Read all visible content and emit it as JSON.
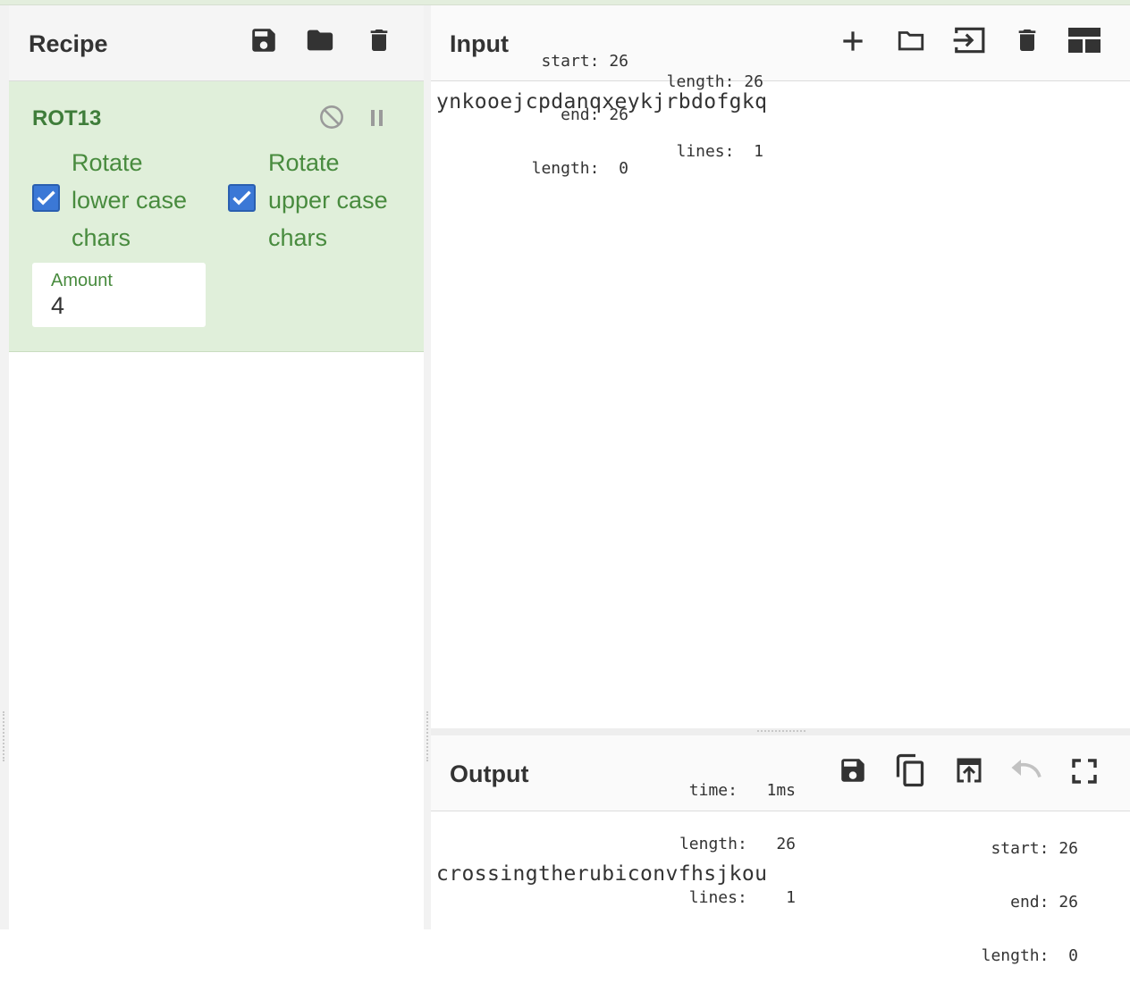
{
  "recipe": {
    "title": "Recipe",
    "icons": [
      "save-icon",
      "folder-icon",
      "trash-icon"
    ],
    "operation": {
      "name": "ROT13",
      "icons": [
        "disable-icon",
        "pause-icon"
      ],
      "options": [
        {
          "label_lines": [
            "Rotate",
            "lower case",
            "chars"
          ],
          "checked": true
        },
        {
          "label_lines": [
            "Rotate",
            "upper case",
            "chars"
          ],
          "checked": true
        }
      ],
      "amount": {
        "label": "Amount",
        "value": "4"
      }
    }
  },
  "input": {
    "title": "Input",
    "selection": {
      "start_label": "start:",
      "start": "26",
      "end_label": "end:",
      "end": "26",
      "length_label": "length:",
      "length": "0"
    },
    "stats": {
      "length_label": "length:",
      "length": "26",
      "lines_label": "lines:",
      "lines": "1"
    },
    "icons": [
      "plus-icon",
      "folder-open-icon",
      "import-icon",
      "trash-icon",
      "layout-icon"
    ],
    "text": "ynkooejcpdanqxeykjrbdofgkq"
  },
  "output": {
    "title": "Output",
    "stats": {
      "time_label": "time:",
      "time": "1ms",
      "length_label": "length:",
      "length": "26",
      "lines_label": "lines:",
      "lines": "1"
    },
    "icons": [
      "save-icon",
      "copy-icon",
      "replace-input-icon",
      "undo-icon",
      "fullscreen-icon"
    ],
    "selection": {
      "start_label": "start:",
      "start": "26",
      "end_label": "end:",
      "end": "26",
      "length_label": "length:",
      "length": "0"
    },
    "text": "crossingtherubiconvfhsjkou"
  },
  "colors": {
    "accent_green": "#488b3e",
    "checkbox_blue": "#3b78d6",
    "operation_bg": "#e0efda"
  }
}
